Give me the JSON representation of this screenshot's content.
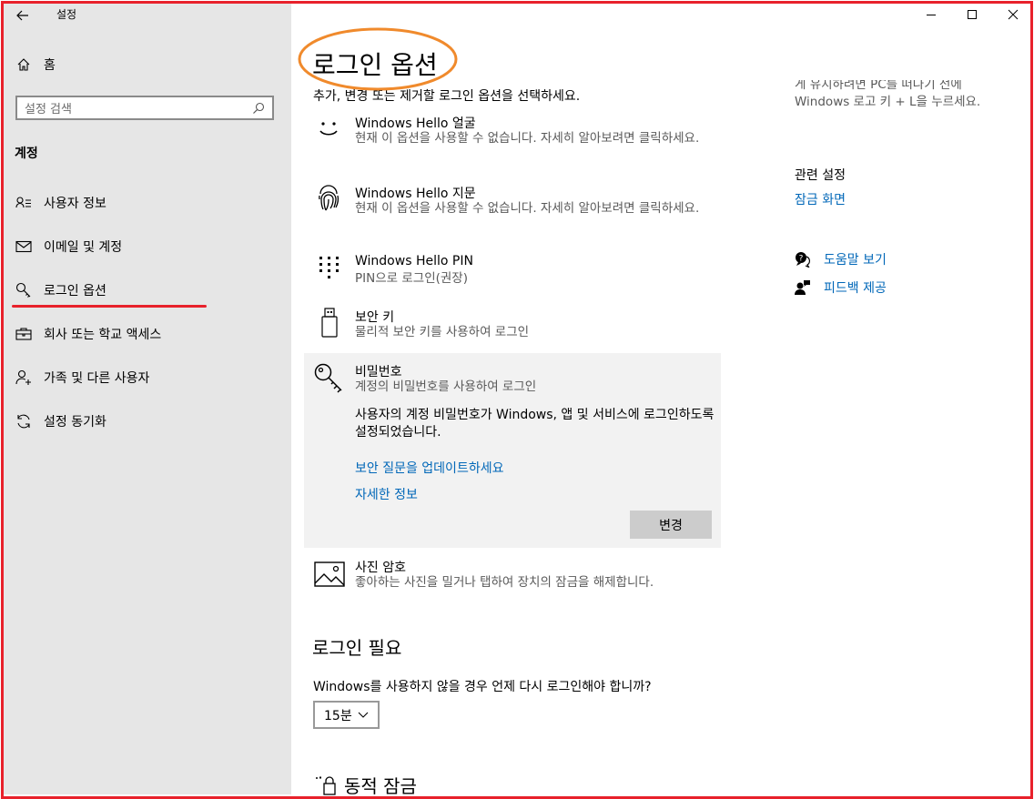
{
  "window": {
    "title": "설정",
    "minimize_icon": "minimize-icon",
    "maximize_icon": "maximize-icon",
    "close_icon": "close-icon"
  },
  "sidebar": {
    "home_label": "홈",
    "search_placeholder": "설정 검색",
    "section_title": "계정",
    "items": [
      {
        "label": "사용자 정보",
        "icon": "user-info-icon"
      },
      {
        "label": "이메일 및 계정",
        "icon": "mail-icon"
      },
      {
        "label": "로그인 옵션",
        "icon": "key-icon"
      },
      {
        "label": "회사 또는 학교 액세스",
        "icon": "briefcase-icon"
      },
      {
        "label": "가족 및 다른 사용자",
        "icon": "add-user-icon"
      },
      {
        "label": "설정 동기화",
        "icon": "sync-icon"
      }
    ],
    "selected_index": 2
  },
  "main": {
    "page_title": "로그인 옵션",
    "subtitle": "추가, 변경 또는 제거할 로그인 옵션을 선택하세요.",
    "options": [
      {
        "title": "Windows Hello 얼굴",
        "desc": "현재 이 옵션을 사용할 수 없습니다. 자세히 알아보려면 클릭하세요.",
        "icon": "face-icon"
      },
      {
        "title": "Windows Hello 지문",
        "desc": "현재 이 옵션을 사용할 수 없습니다. 자세히 알아보려면 클릭하세요.",
        "icon": "fingerprint-icon"
      },
      {
        "title": "Windows Hello PIN",
        "desc": "PIN으로 로그인(권장)",
        "icon": "pin-keypad-icon"
      },
      {
        "title": "보안 키",
        "desc": "물리적 보안 키를 사용하여 로그인",
        "icon": "usb-key-icon"
      },
      {
        "title": "비밀번호",
        "desc": "계정의 비밀번호를 사용하여 로그인",
        "icon": "password-key-icon"
      },
      {
        "title": "사진 암호",
        "desc": "좋아하는 사진을 밀거나 탭하여 장치의 잠금을 해제합니다.",
        "icon": "picture-icon"
      }
    ],
    "password_expanded": {
      "info": "사용자의 계정 비밀번호가 Windows, 앱 및 서비스에 로그인하도록 설정되었습니다.",
      "link_update": "보안 질문을 업데이트하세요",
      "link_more": "자세한 정보",
      "change_button": "변경"
    },
    "require_signin": {
      "heading": "로그인 필요",
      "question": "Windows를 사용하지 않을 경우 언제 다시 로그인해야 합니까?",
      "selected": "15분"
    },
    "dynamic_lock": {
      "heading": "동적 잠금",
      "icon": "dynamic-lock-icon"
    }
  },
  "right_panel": {
    "top_text_line1": "게 유지하려면 PC를 떠나기 전에",
    "top_text_line2": "Windows 로고 키 + L을 누르세요.",
    "related_title": "관련 설정",
    "related_link": "잠금 화면",
    "help_link": "도움말 보기",
    "feedback_link": "피드백 제공"
  },
  "colors": {
    "accent": "#0067b8",
    "sidebar_bg": "#e6e6e6",
    "frame_red": "#e8212b",
    "highlight_orange": "#f08a2c"
  }
}
